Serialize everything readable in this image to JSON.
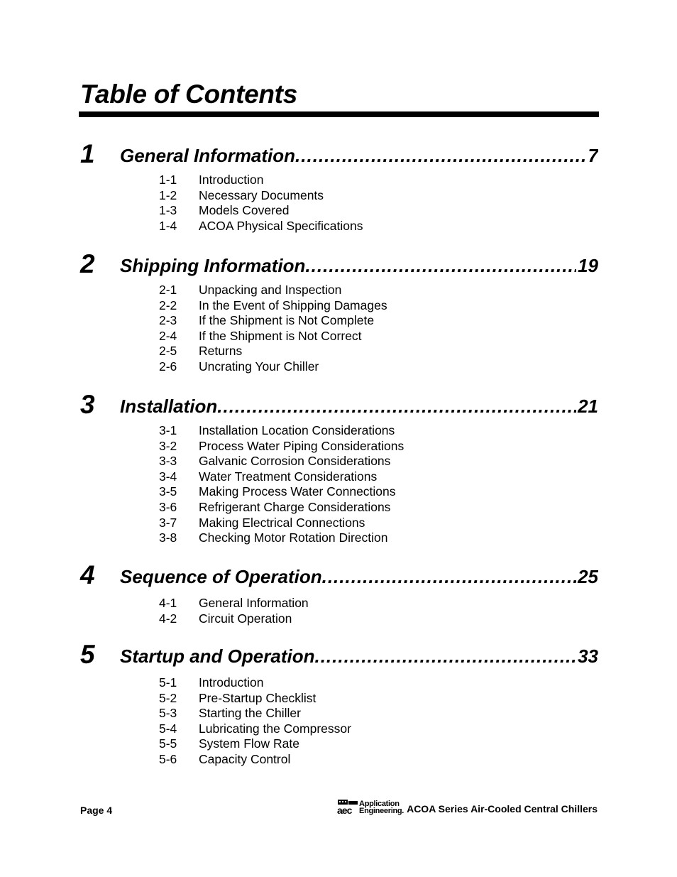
{
  "page": {
    "title": "Table of Contents"
  },
  "chapters": [
    {
      "number": "1",
      "title": "General Information",
      "page": "7",
      "sections": [
        {
          "num": "1-1",
          "label": "Introduction"
        },
        {
          "num": "1-2",
          "label": "Necessary Documents"
        },
        {
          "num": "1-3",
          "label": "Models Covered"
        },
        {
          "num": "1-4",
          "label": "ACOA Physical Specifications"
        }
      ]
    },
    {
      "number": "2",
      "title": "Shipping Information",
      "page": "19",
      "sections": [
        {
          "num": "2-1",
          "label": "Unpacking and Inspection"
        },
        {
          "num": "2-2",
          "label": "In the Event of Shipping Damages"
        },
        {
          "num": "2-3",
          "label": "If the Shipment is Not Complete"
        },
        {
          "num": "2-4",
          "label": "If the Shipment is Not Correct"
        },
        {
          "num": "2-5",
          "label": "Returns"
        },
        {
          "num": "2-6",
          "label": "Uncrating Your Chiller"
        }
      ]
    },
    {
      "number": "3",
      "title": "Installation",
      "page": "21",
      "sections": [
        {
          "num": "3-1",
          "label": "Installation Location Considerations"
        },
        {
          "num": "3-2",
          "label": "Process Water Piping Considerations"
        },
        {
          "num": "3-3",
          "label": "Galvanic Corrosion Considerations"
        },
        {
          "num": "3-4",
          "label": "Water Treatment Considerations"
        },
        {
          "num": "3-5",
          "label": "Making Process Water Connections"
        },
        {
          "num": "3-6",
          "label": "Refrigerant Charge Considerations"
        },
        {
          "num": "3-7",
          "label": "Making Electrical Connections"
        },
        {
          "num": "3-8",
          "label": "Checking Motor Rotation Direction"
        }
      ]
    },
    {
      "number": "4",
      "title": "Sequence of Operation",
      "page": "25",
      "sections": [
        {
          "num": "4-1",
          "label": "General Information"
        },
        {
          "num": "4-2",
          "label": "Circuit Operation"
        }
      ]
    },
    {
      "number": "5",
      "title": "Startup and Operation",
      "page": "33",
      "sections": [
        {
          "num": "5-1",
          "label": "Introduction"
        },
        {
          "num": "5-2",
          "label": "Pre-Startup Checklist"
        },
        {
          "num": "5-3",
          "label": "Starting the Chiller"
        },
        {
          "num": "5-4",
          "label": "Lubricating the Compressor"
        },
        {
          "num": "5-5",
          "label": "System Flow Rate"
        },
        {
          "num": "5-6",
          "label": "Capacity Control"
        }
      ]
    }
  ],
  "footer": {
    "page_label": "Page 4",
    "logo_line1": "Application",
    "logo_line2": "Engineering.",
    "logo_icon": "aec-logo-icon",
    "document_title": "ACOA Series Air-Cooled Central Chillers"
  }
}
